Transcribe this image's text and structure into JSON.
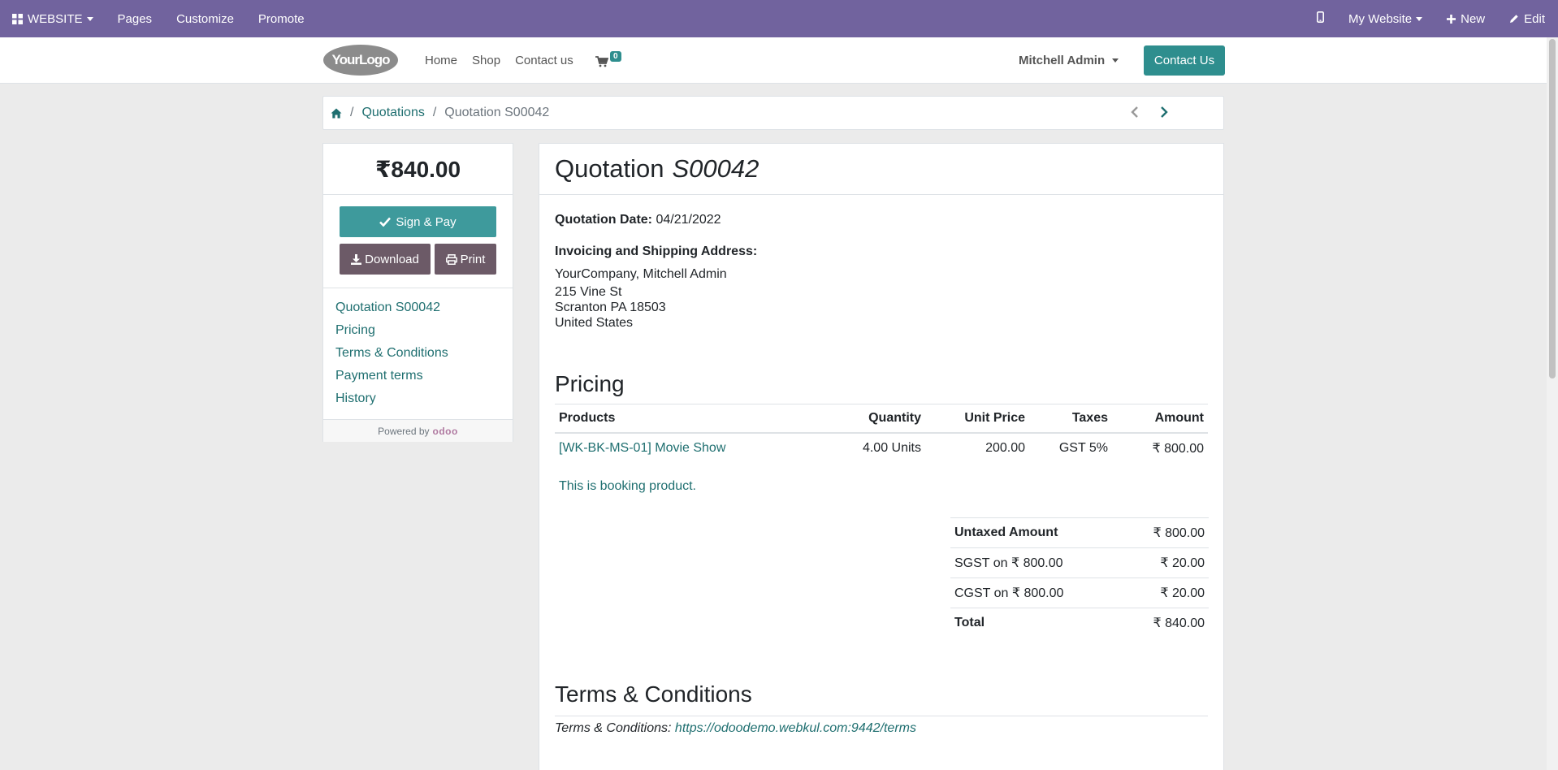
{
  "adminbar": {
    "apps_label": "WEBSITE",
    "pages": "Pages",
    "customize": "Customize",
    "promote": "Promote",
    "website_select": "My Website",
    "new": "New",
    "edit": "Edit"
  },
  "header": {
    "logo_text": "YourLogo",
    "nav": [
      "Home",
      "Shop",
      "Contact us"
    ],
    "cart_count": "0",
    "user": "Mitchell Admin",
    "contact_button": "Contact Us"
  },
  "breadcrumb": {
    "quotations": "Quotations",
    "current": "Quotation S00042"
  },
  "sidebar": {
    "amount": "₹840.00",
    "sign_pay": "Sign & Pay",
    "download": "Download",
    "print": "Print",
    "toc": [
      "Quotation S00042",
      "Pricing",
      "Terms & Conditions",
      "Payment terms",
      "History"
    ],
    "powered_by": "Powered by",
    "odoo": "odoo"
  },
  "quotation": {
    "title": "Quotation",
    "number": "S00042",
    "date_label": "Quotation Date:",
    "date": "04/21/2022",
    "address_label": "Invoicing and Shipping Address:",
    "address": [
      "YourCompany, Mitchell Admin",
      "215 Vine St",
      "Scranton PA 18503",
      "United States"
    ]
  },
  "pricing": {
    "heading": "Pricing",
    "columns": [
      "Products",
      "Quantity",
      "Unit Price",
      "Taxes",
      "Amount"
    ],
    "rows": [
      {
        "product": "[WK-BK-MS-01] Movie Show",
        "quantity": "4.00 Units",
        "unit_price": "200.00",
        "taxes": "GST 5%",
        "amount": "₹ 800.00"
      }
    ],
    "note": "This is booking product.",
    "totals": [
      {
        "label": "Untaxed Amount",
        "value": "₹ 800.00",
        "bold": true
      },
      {
        "label": "SGST on ₹ 800.00",
        "value": "₹ 20.00",
        "bold": false
      },
      {
        "label": "CGST on ₹ 800.00",
        "value": "₹ 20.00",
        "bold": false
      },
      {
        "label": "Total",
        "value": "₹ 840.00",
        "bold": true
      }
    ]
  },
  "terms": {
    "heading": "Terms & Conditions",
    "label": "Terms & Conditions:",
    "url": "https://odoodemo.webkul.com:9442/terms"
  }
}
